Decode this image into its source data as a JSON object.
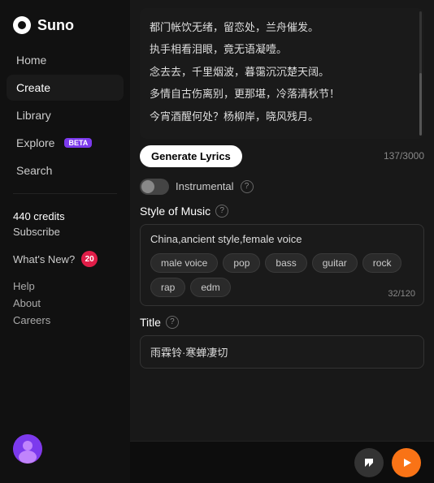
{
  "app": {
    "name": "Suno"
  },
  "sidebar": {
    "nav_items": [
      {
        "id": "home",
        "label": "Home",
        "active": false
      },
      {
        "id": "create",
        "label": "Create",
        "active": true
      },
      {
        "id": "library",
        "label": "Library",
        "active": false
      },
      {
        "id": "explore",
        "label": "Explore",
        "active": false,
        "badge": "BETA"
      },
      {
        "id": "search",
        "label": "Search",
        "active": false
      }
    ],
    "credits": "440 credits",
    "subscribe": "Subscribe",
    "whats_new": "What's New?",
    "whats_new_badge": "20",
    "help": "Help",
    "about": "About",
    "careers": "Careers"
  },
  "lyrics": {
    "lines": [
      "都门帐饮无绪，留恋处，兰舟催发。",
      "执手相看泪眼，竟无语凝噎。",
      "念去去，千里烟波，暮霭沉沉楚天阔。",
      "多情自古伤离别，更那堪，冷落清秋节！",
      "今宵酒醒何处？杨柳岸，晓风残月。"
    ],
    "generate_lyrics_btn": "Generate Lyrics",
    "char_count": "137/3000"
  },
  "instrumental": {
    "label": "Instrumental",
    "enabled": false
  },
  "style_of_music": {
    "label": "Style of Music",
    "value": "China,ancient style,female voice",
    "tags": [
      "male voice",
      "pop",
      "bass",
      "guitar",
      "rock",
      "rap",
      "edm"
    ],
    "char_count": "32/120"
  },
  "title": {
    "label": "Title",
    "value": "雨霖铃·寒蝉凄切"
  },
  "player": {
    "skip_label": "⏮",
    "play_label": "▶"
  }
}
